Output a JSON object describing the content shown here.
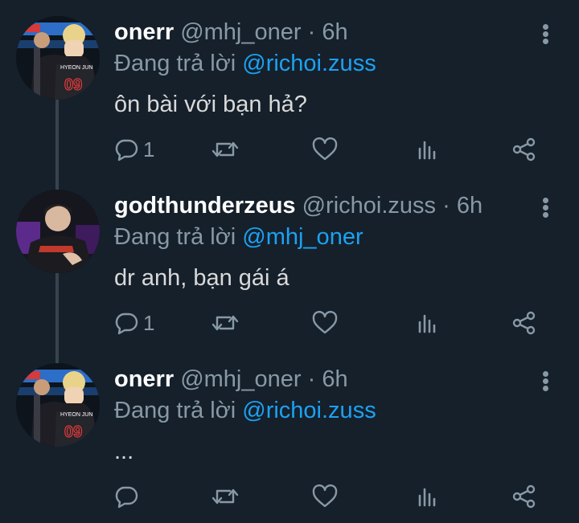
{
  "tweets": [
    {
      "name": "onerr",
      "handle": "@mhj_oner",
      "sep": "·",
      "time": "6h",
      "replying_prefix": "Đang trả lời",
      "replying_to": "@richoi.zuss",
      "text": "ôn bài với bạn hả?",
      "reply_count": "1",
      "avatar_jersey_name": "HYEON JUN",
      "avatar_jersey_number": "09"
    },
    {
      "name": "godthunderzeus",
      "handle": "@richoi.zuss",
      "sep": "·",
      "time": "6h",
      "replying_prefix": "Đang trả lời",
      "replying_to": "@mhj_oner",
      "text": "dr anh, bạn gái á",
      "reply_count": "1"
    },
    {
      "name": "onerr",
      "handle": "@mhj_oner",
      "sep": "·",
      "time": "6h",
      "replying_prefix": "Đang trả lời",
      "replying_to": "@richoi.zuss",
      "text": "...",
      "reply_count": "",
      "avatar_jersey_name": "HYEON JUN",
      "avatar_jersey_number": "09"
    }
  ],
  "icons": {
    "reply": "reply-icon",
    "retweet": "retweet-icon",
    "like": "heart-icon",
    "analytics": "analytics-icon",
    "share": "share-icon",
    "more": "more-vertical-icon"
  },
  "colors": {
    "background": "#15202b",
    "accent": "#1da1f2",
    "secondary_text": "#8899a6",
    "primary_text": "#d9d9d9",
    "thread_line": "#38444d"
  }
}
